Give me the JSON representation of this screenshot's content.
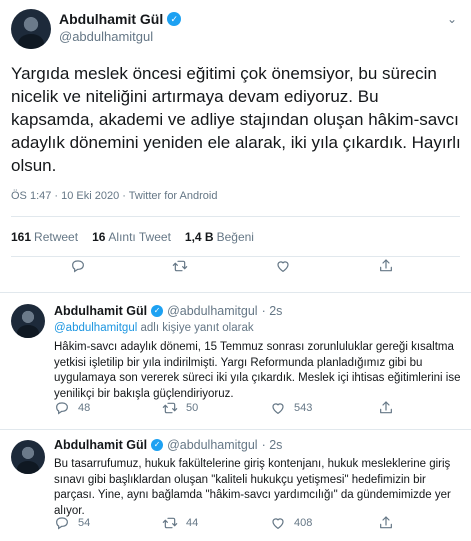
{
  "main": {
    "name": "Abdulhamit Gül",
    "handle": "@abdulhamitgul",
    "verified_mark": "✓",
    "caret": "⌄",
    "text": "Yargıda meslek öncesi eğitimi çok önemsiyor, bu sürecin nicelik ve niteliğini artırmaya devam ediyoruz. Bu kapsamda, akademi ve adliye stajından oluşan hâkim-savcı adaylık dönemini yeniden ele alarak, iki yıla çıkardık. Hayırlı olsun.",
    "meta": "ÖS 1:47 · 10 Eki 2020 · Twitter for Android",
    "stats": {
      "retweets_count": "161",
      "retweets_label": "Retweet",
      "quotes_count": "16",
      "quotes_label": "Alıntı Tweet",
      "likes_count": "1,4 B",
      "likes_label": "Beğeni"
    }
  },
  "replies": [
    {
      "name": "Abdulhamit Gül",
      "handle": "@abdulhamitgul",
      "time": "· 2s",
      "reply_to_mention": "@abdulhamitgul",
      "reply_to_suffix": " adlı kişiye yanıt olarak",
      "text": "Hâkim-savcı adaylık dönemi, 15 Temmuz sonrası zorunluluklar gereği kısaltma yetkisi işletilip bir yıla indirilmişti. Yargı Reformunda planladığımız gibi bu uygulamaya son vererek süreci iki yıla çıkardık. Meslek içi ihtisas eğitimlerini ise yenilikçi bir bakışla güçlendiriyoruz.",
      "reply_count": "48",
      "retweet_count": "50",
      "like_count": "543"
    },
    {
      "name": "Abdulhamit Gül",
      "handle": "@abdulhamitgul",
      "time": "· 2s",
      "text": "Bu tasarrufumuz, hukuk fakültelerine giriş kontenjanı, hukuk mesleklerine giriş sınavı gibi başlıklardan oluşan \"kaliteli hukukçu yetişmesi\" hedefimizin bir parçası. Yine, aynı bağlamda \"hâkim-savcı yardımcılığı\" da gündemimizde yer alıyor.",
      "reply_count": "54",
      "retweet_count": "44",
      "like_count": "408"
    }
  ],
  "icons": {
    "reply": "reply-icon",
    "retweet": "retweet-icon",
    "like": "heart-icon",
    "share": "share-icon"
  },
  "colors": {
    "text": "#14171a",
    "muted": "#657786",
    "accent": "#1da1f2",
    "divider": "#e1e8ed"
  }
}
